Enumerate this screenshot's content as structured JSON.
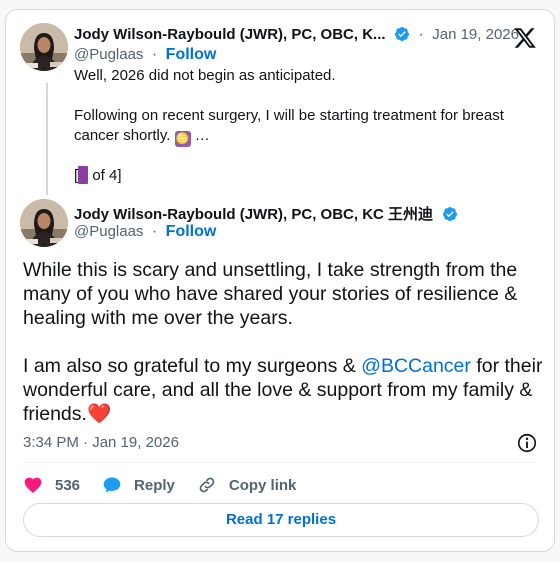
{
  "first_tweet": {
    "author_name": "Jody Wilson-Raybould (JWR), PC, OBC, K...",
    "handle": "@Puglaas",
    "follow_label": "Follow",
    "date": "Jan 19, 2026",
    "line1": "Well, 2026 did not begin as anticipated.",
    "line2": "Following on recent surgery, I will be starting treatment for breast",
    "line3_text": "cancer shortly.",
    "line3_emoji": "♋",
    "line3_more": "…",
    "line4_open": "[",
    "line4_rest": " of 4]"
  },
  "main_tweet": {
    "author_name": "Jody Wilson-Raybould (JWR), PC, OBC, KC 王州迪",
    "handle": "@Puglaas",
    "follow_label": "Follow",
    "para1": "While this is scary and unsettling, I take strength from the many of you who have shared your stories of resilience & healing with me over the years.",
    "para2_before": "I am also so grateful to my surgeons & ",
    "para2_mention": "@BCCancer",
    "para2_after": " for their wonderful care, and all the love & support from my family & friends.",
    "para2_emoji": "❤️",
    "timestamp": "3:34 PM · Jan 19, 2026"
  },
  "actions": {
    "like_count": "536",
    "reply_label": "Reply",
    "copy_label": "Copy link"
  },
  "read_replies_label": "Read 17 replies",
  "separator": "·",
  "colors": {
    "link": "#006fd6",
    "muted": "#536471",
    "heart": "#f91880",
    "verified": "#1d9bf0"
  }
}
